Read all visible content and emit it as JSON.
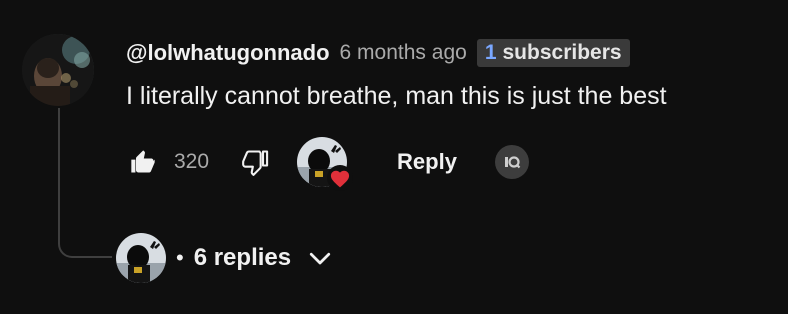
{
  "comment": {
    "author_handle": "@lolwhatugonnado",
    "time_ago": "6 months ago",
    "subscriber_badge": {
      "count": "1",
      "label": "subscribers"
    },
    "text": "I literally cannot breathe, man this is just the best",
    "like_count": "320",
    "reply_label": "Reply"
  },
  "replies": {
    "bullet": "•",
    "label": "6 replies"
  },
  "colors": {
    "background": "#0f0f0f",
    "text_primary": "#f1f1f1",
    "text_secondary": "#aaaaaa",
    "badge_bg": "#3a3a3a",
    "badge_count": "#7aa7ff",
    "heart": "#e0303a",
    "thread_line": "#3f3f3f"
  },
  "icons": {
    "like": "thumbs-up-icon",
    "dislike": "thumbs-down-icon",
    "heart": "creator-heart-icon",
    "extension": "extension-icon",
    "expand": "chevron-down-icon"
  }
}
